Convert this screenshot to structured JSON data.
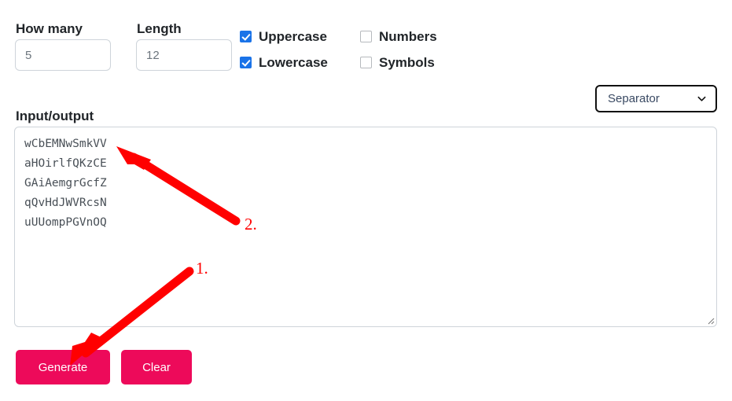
{
  "form": {
    "how_many": {
      "label": "How many",
      "value": "5",
      "placeholder": "5"
    },
    "length": {
      "label": "Length",
      "value": "12",
      "placeholder": "12"
    },
    "options": [
      {
        "label": "Uppercase",
        "checked": true
      },
      {
        "label": "Lowercase",
        "checked": true
      },
      {
        "label": "Numbers",
        "checked": false
      },
      {
        "label": "Symbols",
        "checked": false
      }
    ],
    "separator": {
      "selected": "Separator",
      "icon": "chevron-down-icon"
    }
  },
  "io": {
    "label": "Input/output",
    "lines": [
      "wCbEMNwSmkVV",
      "aHOirlfQKzCE",
      "GAiAemgrGcfZ",
      "qQvHdJWVRcsN",
      "uUUompPGVnOQ"
    ],
    "resize_icon": "resize-grip-icon"
  },
  "actions": {
    "generate_label": "Generate",
    "clear_label": "Clear"
  },
  "annotations": [
    {
      "marker": "1.",
      "target": "generate-button"
    },
    {
      "marker": "2.",
      "target": "io-textarea-line-2"
    }
  ],
  "colors": {
    "button": "#ed0a5a",
    "checkbox_checked": "#1a73e8",
    "annotation": "#ff0000",
    "text": "#212529",
    "input_text": "#6c757d",
    "border": "#ced4da"
  }
}
